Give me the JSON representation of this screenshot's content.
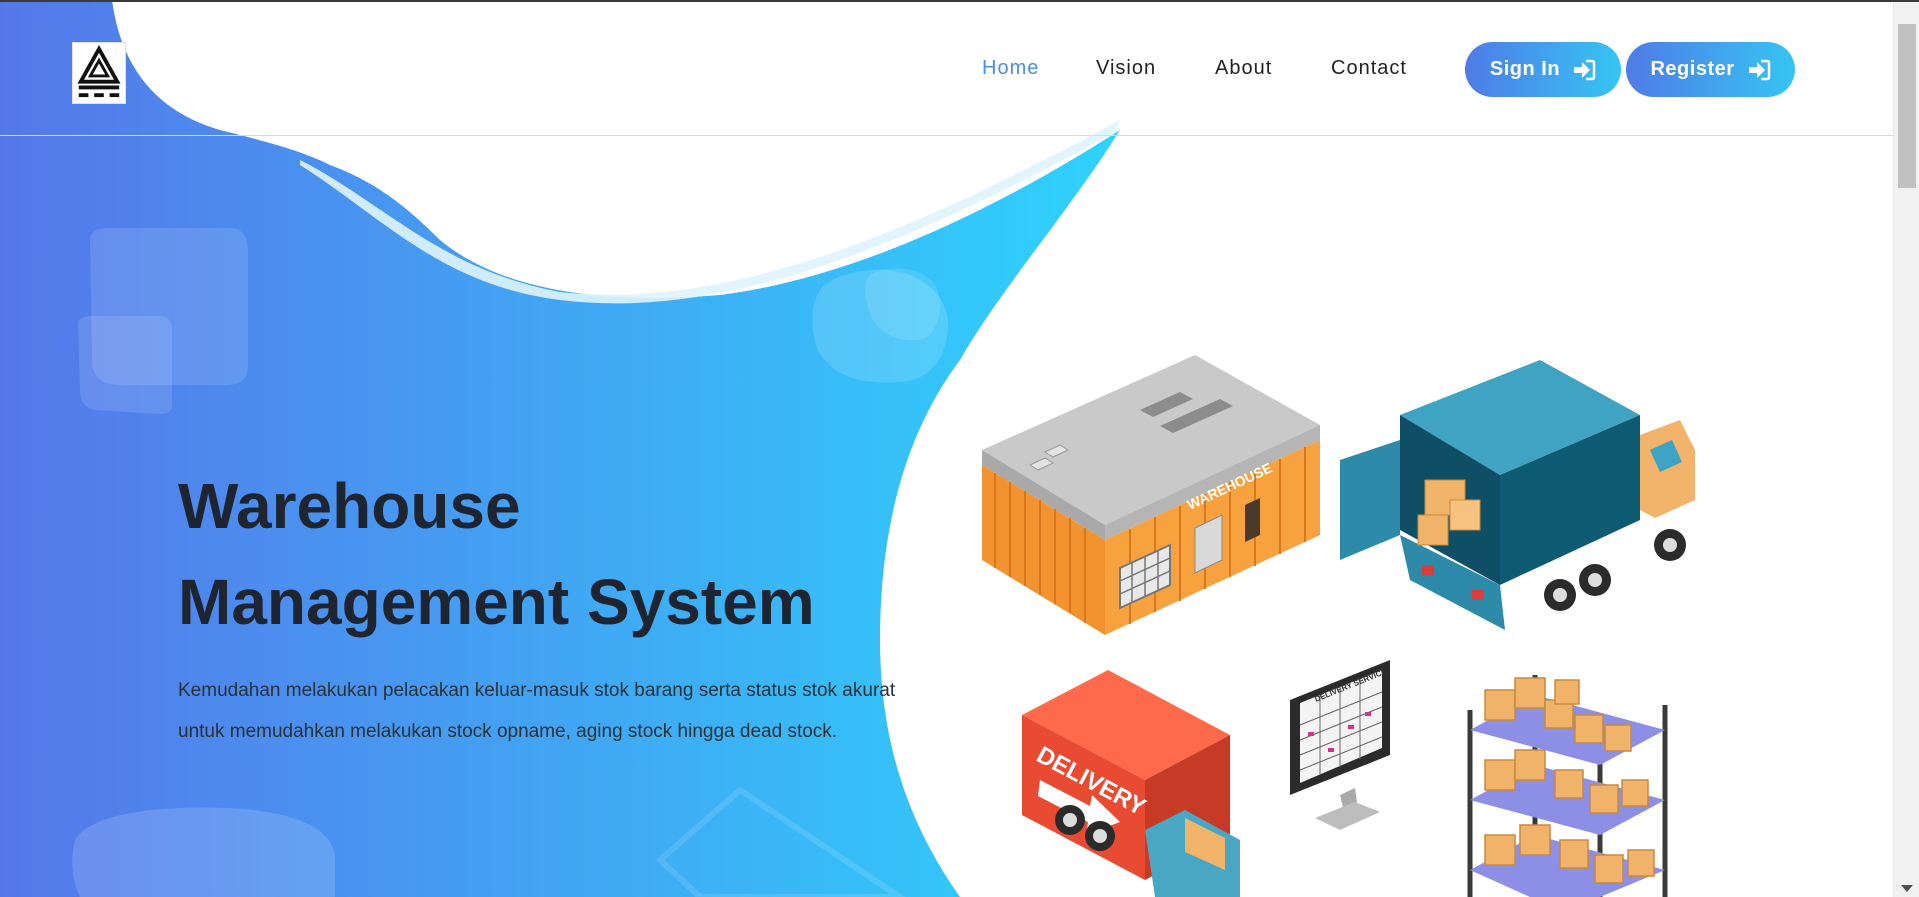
{
  "nav": {
    "home": "Home",
    "vision": "Vision",
    "about": "About",
    "contact": "Contact",
    "signin": "Sign In",
    "register": "Register"
  },
  "hero": {
    "title_line1": "Warehouse",
    "title_line2": "Management System",
    "description": "Kemudahan melakukan pelacakan keluar-masuk stok barang serta status stok akurat untuk memudahkan melakukan stock opname, aging stock hingga dead stock."
  },
  "illustration": {
    "warehouse_sign": "WAREHOUSE",
    "truck_label": "DELIVERY",
    "monitor_label": "DELIVERY SERVICE"
  },
  "colors": {
    "gradient_start": "#5577ea",
    "gradient_end": "#2ed3fc",
    "active_link": "#4a8fe0",
    "title": "#1f2530"
  }
}
